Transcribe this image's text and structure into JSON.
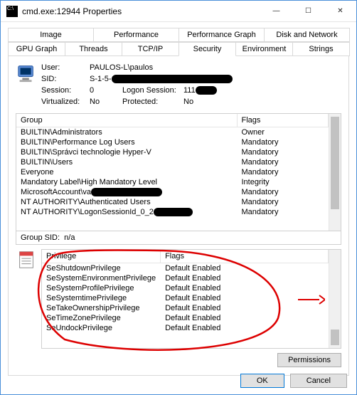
{
  "window": {
    "title": "cmd.exe:12944 Properties",
    "minimize": "—",
    "maximize": "☐",
    "close": "✕"
  },
  "tabs": {
    "row1": [
      "Image",
      "Performance",
      "Performance Graph",
      "Disk and Network"
    ],
    "row2": [
      "GPU Graph",
      "Threads",
      "TCP/IP",
      "Security",
      "Environment",
      "Strings"
    ],
    "active": "Security"
  },
  "info": {
    "user_lbl": "User:",
    "user_val": "PAULOS-L\\paulos",
    "sid_lbl": "SID:",
    "sid_val": "S-1-5-",
    "session_lbl": "Session:",
    "session_val": "0",
    "logon_lbl": "Logon Session:",
    "logon_val": "111",
    "virt_lbl": "Virtualized:",
    "virt_val": "No",
    "prot_lbl": "Protected:",
    "prot_val": "No"
  },
  "groups": {
    "col_group": "Group",
    "col_flags": "Flags",
    "rows": [
      {
        "g": "BUILTIN\\Administrators",
        "f": "Owner"
      },
      {
        "g": "BUILTIN\\Performance Log Users",
        "f": "Mandatory"
      },
      {
        "g": "BUILTIN\\Správci technologie Hyper-V",
        "f": "Mandatory"
      },
      {
        "g": "BUILTIN\\Users",
        "f": "Mandatory"
      },
      {
        "g": "Everyone",
        "f": "Mandatory"
      },
      {
        "g": "Mandatory Label\\High Mandatory Level",
        "f": "Integrity"
      },
      {
        "g": "MicrosoftAccount\\va",
        "f": "Mandatory",
        "redact": 100
      },
      {
        "g": "NT AUTHORITY\\Authenticated Users",
        "f": "Mandatory"
      },
      {
        "g": "NT AUTHORITY\\LogonSessionId_0_2",
        "f": "Mandatory",
        "redact": 55
      }
    ],
    "sid_lbl": "Group SID:",
    "sid_val": "n/a"
  },
  "privs": {
    "col_priv": "Privilege",
    "col_flags": "Flags",
    "rows": [
      {
        "p": "SeShutdownPrivilege",
        "f": "Default Enabled"
      },
      {
        "p": "SeSystemEnvironmentPrivilege",
        "f": "Default Enabled"
      },
      {
        "p": "SeSystemProfilePrivilege",
        "f": "Default Enabled"
      },
      {
        "p": "SeSystemtimePrivilege",
        "f": "Default Enabled"
      },
      {
        "p": "SeTakeOwnershipPrivilege",
        "f": "Default Enabled"
      },
      {
        "p": "SeTimeZonePrivilege",
        "f": "Default Enabled"
      },
      {
        "p": "SeUndockPrivilege",
        "f": "Default Enabled"
      }
    ]
  },
  "buttons": {
    "permissions": "Permissions",
    "ok": "OK",
    "cancel": "Cancel"
  }
}
